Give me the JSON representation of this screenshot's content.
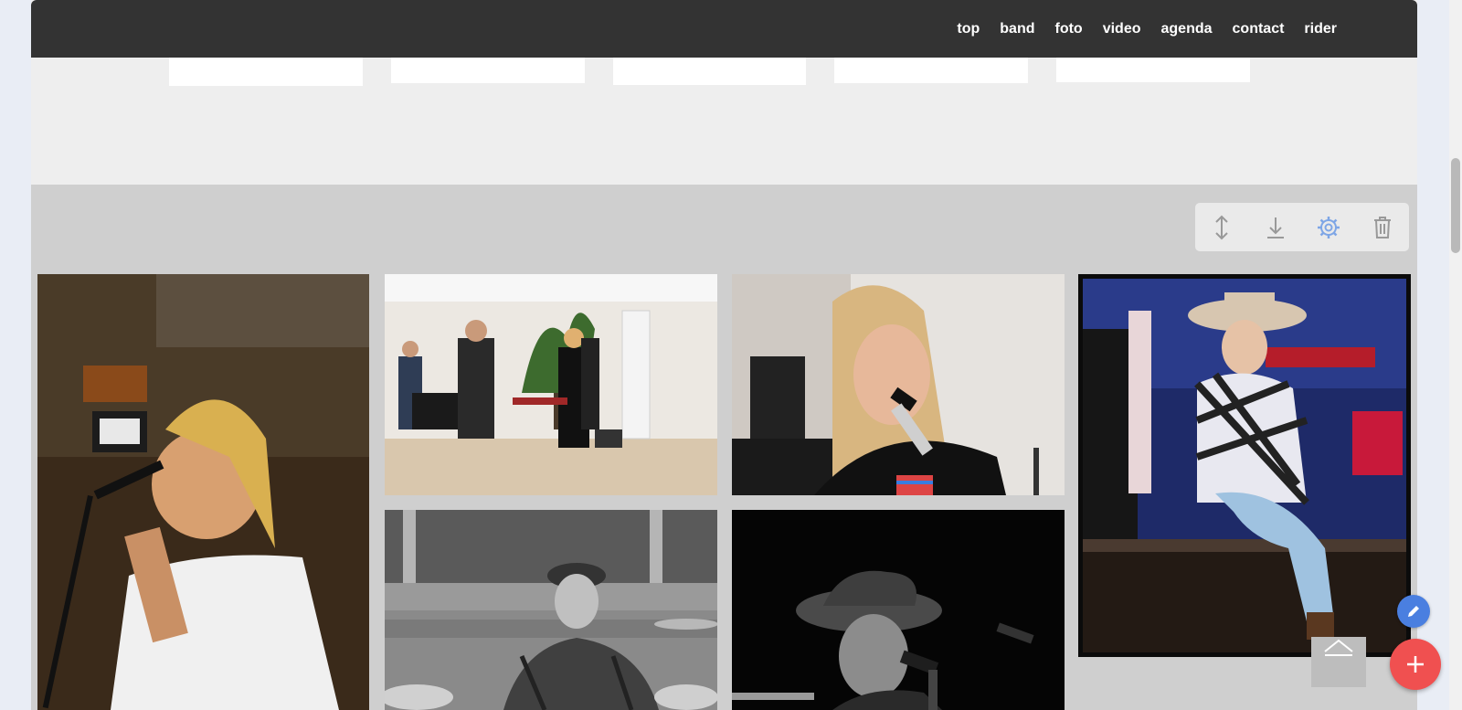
{
  "nav": {
    "items": [
      {
        "label": "top"
      },
      {
        "label": "band"
      },
      {
        "label": "foto"
      },
      {
        "label": "video"
      },
      {
        "label": "agenda"
      },
      {
        "label": "contact"
      },
      {
        "label": "rider"
      }
    ]
  },
  "toolbar": {
    "buttons": [
      {
        "icon": "move-vertical-icon"
      },
      {
        "icon": "download-icon"
      },
      {
        "icon": "gear-icon"
      },
      {
        "icon": "trash-icon"
      }
    ]
  },
  "gallery": {
    "photos": [
      {
        "subject": "singer-with-microphone-color"
      },
      {
        "subject": "band-rehearsal-studio"
      },
      {
        "subject": "blonde-singer-closeup"
      },
      {
        "subject": "singer-cowboy-hat-on-stage"
      },
      {
        "subject": "drummer-black-and-white"
      },
      {
        "subject": "singer-cowboy-hat-black-and-white"
      }
    ]
  },
  "colors": {
    "navbar": "#333333",
    "section_bg": "#cfcfcf",
    "accent_blue": "#4a7fe0",
    "accent_red": "#f05050"
  }
}
